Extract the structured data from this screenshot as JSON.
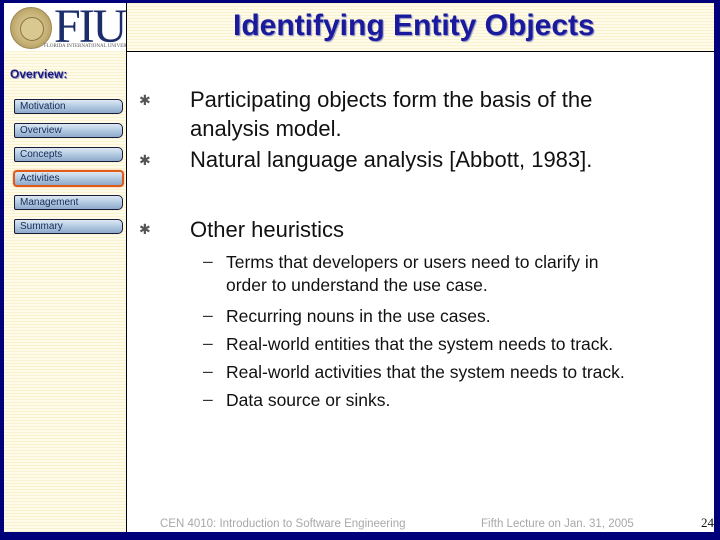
{
  "logo": {
    "text": "FIU",
    "subtext": "FLORIDA INTERNATIONAL UNIVERSITY"
  },
  "header": {
    "title": "Identifying Entity Objects"
  },
  "sidebar": {
    "heading": "Overview:",
    "items": [
      {
        "label": "Motivation",
        "active": false
      },
      {
        "label": "Overview",
        "active": false
      },
      {
        "label": "Concepts",
        "active": false
      },
      {
        "label": "Activities",
        "active": true
      },
      {
        "label": "Management",
        "active": false
      },
      {
        "label": "Summary",
        "active": false
      }
    ]
  },
  "content": {
    "bullet_icon": "asterisk-bullet-icon",
    "bullets": [
      {
        "lines": [
          "Participating objects form the basis of the",
          "analysis model."
        ]
      },
      {
        "lines": [
          "Natural language analysis [Abbott, 1983]."
        ]
      },
      {
        "lines": [
          "Other heuristics"
        ]
      }
    ],
    "sub_bullets": [
      {
        "lines": [
          "Terms that developers or users need to clarify in",
          "order to understand the use case."
        ]
      },
      {
        "lines": [
          "Recurring nouns in the use cases."
        ]
      },
      {
        "lines": [
          "Real-world entities that the system needs to track."
        ]
      },
      {
        "lines": [
          "Real-world activities that the system needs to track."
        ]
      },
      {
        "lines": [
          "Data source or sinks."
        ]
      }
    ],
    "dash": "–",
    "asterisk": "✱"
  },
  "footer": {
    "course": "CEN 4010: Introduction to Software Engineering",
    "lecture": "Fifth Lecture on Jan. 31, 2005",
    "page_number": "24"
  },
  "colors": {
    "frame": "#00007a",
    "title": "#1a1a9c",
    "active_nav_border": "#e05a1c"
  }
}
